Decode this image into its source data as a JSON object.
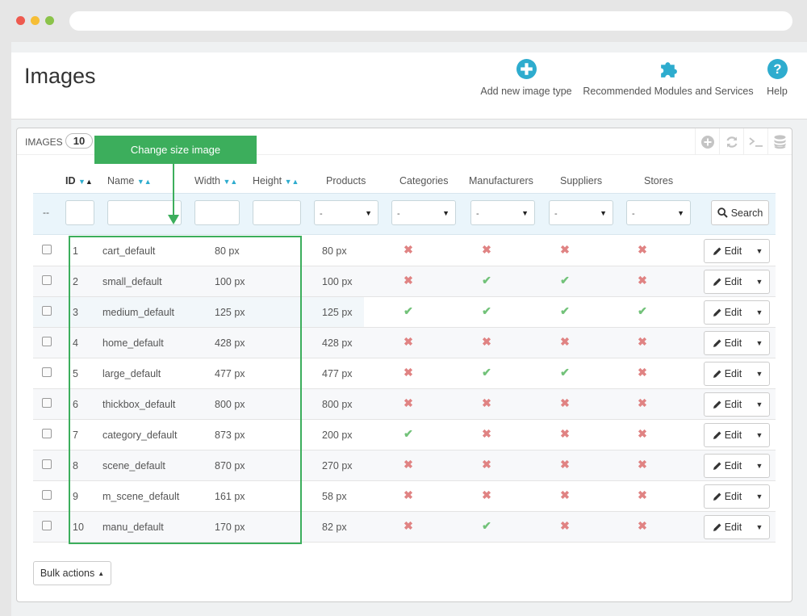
{
  "page_title": "Images",
  "toolbar": {
    "add_label": "Add new image type",
    "recommended_label": "Recommended Modules and Services",
    "help_label": "Help"
  },
  "panel": {
    "title": "IMAGES",
    "count": "10"
  },
  "annotation": {
    "callout": "Change size image",
    "color": "#3cae5c"
  },
  "columns": {
    "id": "ID",
    "name": "Name",
    "width": "Width",
    "height": "Height",
    "products": "Products",
    "categories": "Categories",
    "manufacturers": "Manufacturers",
    "suppliers": "Suppliers",
    "stores": "Stores"
  },
  "filters": {
    "dash": "--",
    "select_value": "-",
    "search_label": "Search"
  },
  "rows": [
    {
      "id": "1",
      "name": "cart_default",
      "width": "80 px",
      "height": "80 px",
      "categories": false,
      "manufacturers": false,
      "suppliers": false,
      "stores": false
    },
    {
      "id": "2",
      "name": "small_default",
      "width": "100 px",
      "height": "100 px",
      "categories": false,
      "manufacturers": true,
      "suppliers": true,
      "stores": false
    },
    {
      "id": "3",
      "name": "medium_default",
      "width": "125 px",
      "height": "125 px",
      "categories": true,
      "manufacturers": true,
      "suppliers": true,
      "stores": true
    },
    {
      "id": "4",
      "name": "home_default",
      "width": "428 px",
      "height": "428 px",
      "categories": false,
      "manufacturers": false,
      "suppliers": false,
      "stores": false
    },
    {
      "id": "5",
      "name": "large_default",
      "width": "477 px",
      "height": "477 px",
      "categories": false,
      "manufacturers": true,
      "suppliers": true,
      "stores": false
    },
    {
      "id": "6",
      "name": "thickbox_default",
      "width": "800 px",
      "height": "800 px",
      "categories": false,
      "manufacturers": false,
      "suppliers": false,
      "stores": false
    },
    {
      "id": "7",
      "name": "category_default",
      "width": "873 px",
      "height": "200 px",
      "categories": true,
      "manufacturers": false,
      "suppliers": false,
      "stores": false
    },
    {
      "id": "8",
      "name": "scene_default",
      "width": "870 px",
      "height": "270 px",
      "categories": false,
      "manufacturers": false,
      "suppliers": false,
      "stores": false
    },
    {
      "id": "9",
      "name": "m_scene_default",
      "width": "161 px",
      "height": "58 px",
      "categories": false,
      "manufacturers": false,
      "suppliers": false,
      "stores": false
    },
    {
      "id": "10",
      "name": "manu_default",
      "width": "170 px",
      "height": "82 px",
      "categories": false,
      "manufacturers": true,
      "suppliers": false,
      "stores": false
    }
  ],
  "row_actions": {
    "edit_label": "Edit"
  },
  "bulk_label": "Bulk actions",
  "colors": {
    "accent": "#2eacce",
    "ok": "#72c279",
    "no": "#e08383"
  }
}
